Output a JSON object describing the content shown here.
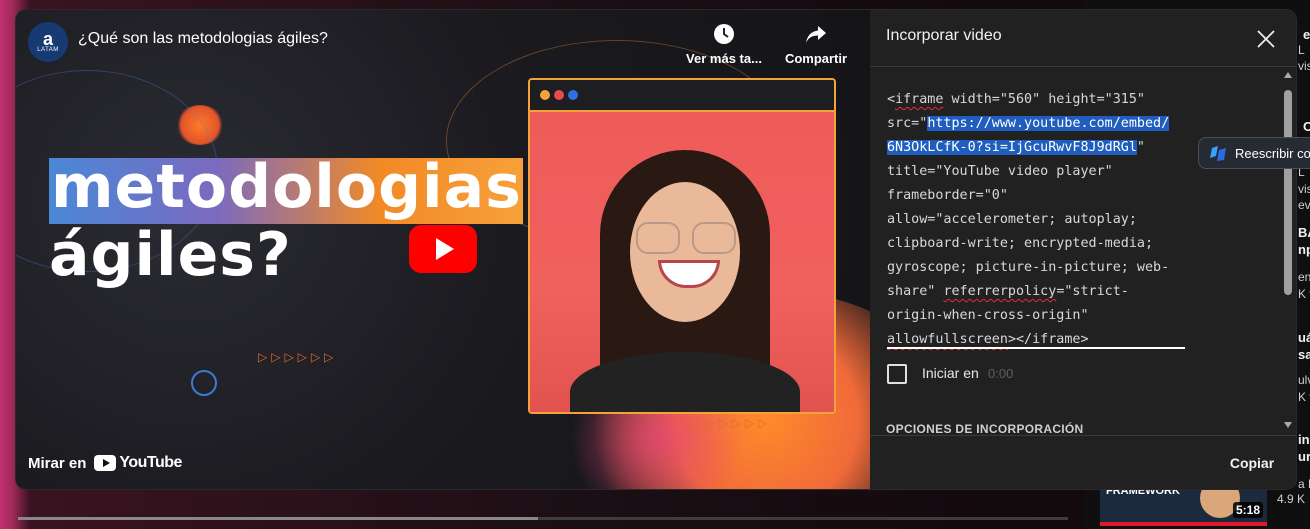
{
  "video": {
    "channel_avatar_letter": "a",
    "channel_avatar_sub": "LATAM",
    "title": "¿Qué son las metodologias ágiles?",
    "watch_later_label": "Ver más ta...",
    "share_label": "Compartir",
    "headline_line1": "metodologias",
    "headline_line2": "ágiles?",
    "watch_on_label": "Mirar en",
    "youtube_logo_text": "YouTube"
  },
  "embed_panel": {
    "title": "Incorporar video",
    "code_lines": [
      {
        "pre": "<",
        "squig": "iframe",
        "post": " width=\"560\" height=\"315\""
      },
      {
        "pre": "src=\"",
        "sel": "https://www.youtube.com/embed/",
        "post": ""
      },
      {
        "pre": "",
        "sel": "6N3OkLCfK-0?si=IjGcuRwvF8J9dRGl",
        "post": "\""
      },
      {
        "pre": "title=\"YouTube video player\"",
        "post": ""
      },
      {
        "pre": "frameborder=\"0\"",
        "post": ""
      },
      {
        "pre": "allow=\"accelerometer; autoplay;",
        "post": ""
      },
      {
        "pre": "clipboard-write; encrypted-media;",
        "post": ""
      },
      {
        "pre": "gyroscope; picture-in-picture; web-",
        "post": ""
      },
      {
        "pre": "share\" ",
        "squig": "referrerpolicy",
        "post": "=\"strict-"
      },
      {
        "pre": "origin-when-cross-origin\"",
        "post": ""
      },
      {
        "pre": "",
        "squig": "allowfullscreen",
        "post": "></iframe>"
      }
    ],
    "start_at_label": "Iniciar en",
    "start_at_time": "0:00",
    "options_header": "OPCIONES DE INCORPORACIÓN",
    "copy_label": "Copiar"
  },
  "rewrite_popup": {
    "label": "Reescribir co"
  },
  "right_sidebar": {
    "thumb_title": "FRAMEWORK",
    "thumb_duration": "5:18",
    "views": "4.9 K"
  },
  "colors": {
    "youtube_red": "#ff0000",
    "selection_blue": "#1f5ebf",
    "panel_bg": "#212121"
  }
}
